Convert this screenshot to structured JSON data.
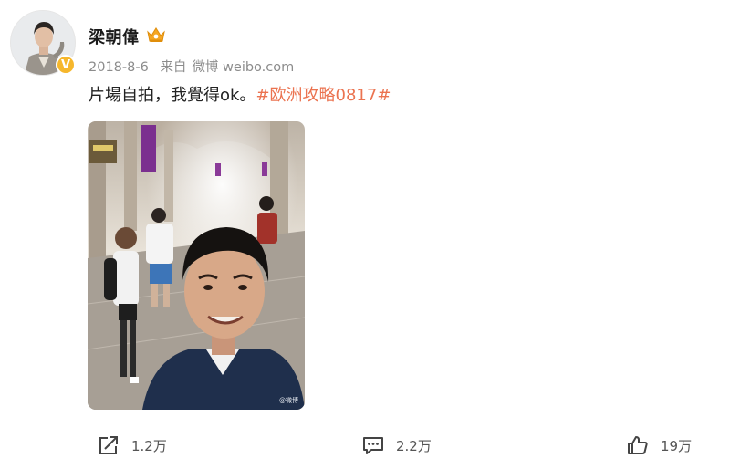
{
  "user": {
    "name": "梁朝偉",
    "avatar_icon": "user-avatar",
    "verified_icon": "verified-v-icon",
    "verified_label": "V"
  },
  "post": {
    "date": "2018-8-6",
    "source_prefix": "来自",
    "source": "微博 weibo.com",
    "text": "片場自拍，我覺得ok。",
    "hashtag": "#欧洲攻略0817#",
    "photo_icon": "selfie-photo",
    "hashtag_color": "#eb7350"
  },
  "actions": {
    "repost_count": "1.2万",
    "comment_count": "2.2万",
    "like_count": "19万"
  }
}
